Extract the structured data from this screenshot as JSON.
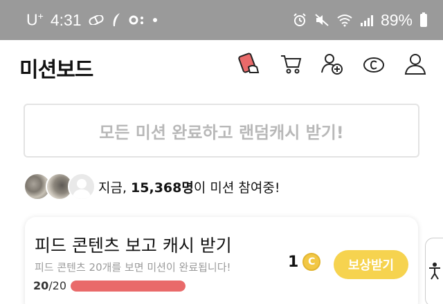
{
  "status_bar": {
    "carrier": "U",
    "carrier_sup": "+",
    "time": "4:31",
    "battery": "89%"
  },
  "header": {
    "title": "미션보드",
    "icons": [
      "mission-card-icon",
      "cart-icon",
      "add-friend-icon",
      "cash-icon",
      "profile-icon"
    ],
    "accent_color": "#e96a6a"
  },
  "banner": {
    "text": "모든 미션 완료하고 랜덤캐시 받기!"
  },
  "participants": {
    "prefix": "지금,",
    "count": "15,368명",
    "suffix": "이 미션 참여중!"
  },
  "mission": {
    "title": "피드 콘텐츠 보고 캐시 받기",
    "description": "피드 콘텐츠 20개를 보면 미션이 완료됩니다!",
    "progress_current": "20",
    "progress_total": "/20",
    "progress_ratio": 1.0,
    "reward_amount": "1",
    "coin_symbol": "C",
    "claim_label": "보상받기",
    "button_color": "#f6d34f"
  }
}
